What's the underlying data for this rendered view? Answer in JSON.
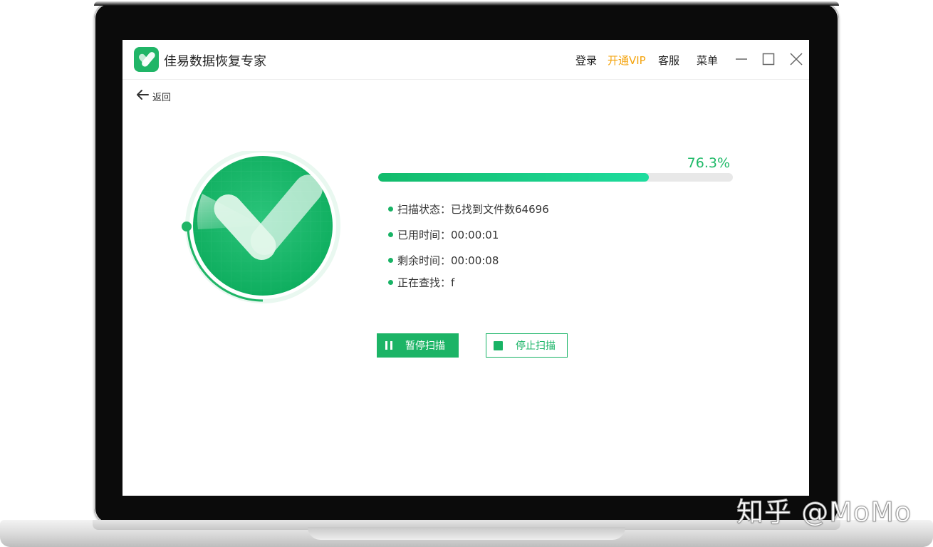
{
  "app": {
    "title": "佳易数据恢复专家",
    "brand_color": "#1cb466",
    "vip_color": "#f4a30c"
  },
  "header_nav": {
    "login": "登录",
    "vip": "开通VIP",
    "service": "客服",
    "menu": "菜单"
  },
  "window_controls": [
    "minimize-icon",
    "maximize-icon",
    "close-icon"
  ],
  "back": {
    "label": "返回",
    "icon": "arrow-left-icon"
  },
  "scan": {
    "progress": 76.3,
    "progress_text": "76.3%",
    "items": [
      {
        "label": "扫描状态：",
        "value": "已找到文件数64696"
      },
      {
        "label": "已用时间：",
        "value": "00:00:01"
      },
      {
        "label": "剩余时间：",
        "value": "00:00:08"
      },
      {
        "label": "正在查找：",
        "value": "f"
      }
    ]
  },
  "buttons": {
    "pause": "暂停扫描",
    "stop": "停止扫描"
  },
  "watermark": "知乎 @MoMo"
}
